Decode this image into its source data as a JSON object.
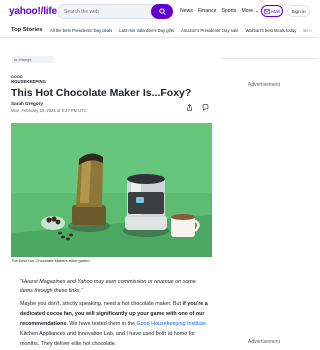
{
  "header": {
    "logo": "yahoo!",
    "logo_suffix": "life",
    "search_placeholder": "Search the web",
    "nav": [
      "News",
      "Finance",
      "Sports",
      "More"
    ],
    "mail_label": "Mail",
    "signin_label": "Sign in",
    "brand_color": "#6001d2"
  },
  "topbar": {
    "title": "Top Stories",
    "items": [
      "All the best Presidents' Day deals",
      "Last-min Valentine's Day gifts",
      "Amazon's Presidents' Day sale",
      "Walmart's best steals today",
      "Best"
    ]
  },
  "article": {
    "prev_tag": "to change",
    "publisher_top": "GOOD",
    "publisher_bottom": "HOUSEKEEPING",
    "title": "This Hot Chocolate Maker Is...Foxy?",
    "author": "Sarah Gregory",
    "date": "Mon, February 10, 2025 at 9:27 PM UTC",
    "caption": "The Best Hot Chocolate Makers mike garten",
    "disclaimer": "\"Hearst Magazines and Yahoo may earn commission or revenue on some items through these links.\"",
    "para_a": "Maybe you don't, strictly speaking, need a hot chocolate maker. But ",
    "para_b": "if you're a dedicated cocoa fan, you will significantly up your game with one of our recommendations.",
    "para_c": " We have tested them in the ",
    "para_link": "Good Housekeeping Institute",
    "para_d": " Kitchen Appliances and Innovation Lab, and I have used both at home for months. They deliver elite hot chocolate."
  },
  "rail": {
    "ad_label_1": "Advertisement",
    "ad_label_2": "Advertisement"
  }
}
